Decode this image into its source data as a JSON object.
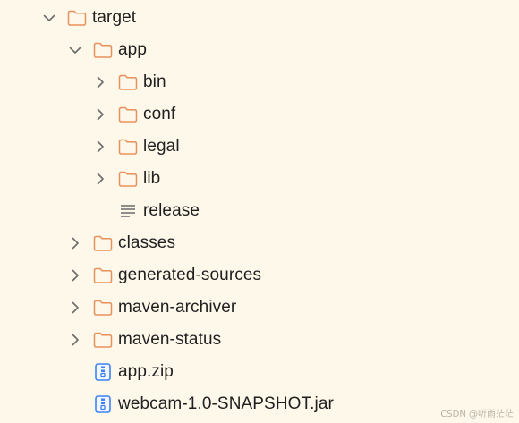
{
  "explorer": {
    "items": [
      {
        "label": "target",
        "type": "folder",
        "expanded": true,
        "depth": 0,
        "icon": "folder-icon"
      },
      {
        "label": "app",
        "type": "folder",
        "expanded": true,
        "depth": 1,
        "icon": "folder-icon"
      },
      {
        "label": "bin",
        "type": "folder",
        "expanded": false,
        "depth": 2,
        "icon": "folder-icon"
      },
      {
        "label": "conf",
        "type": "folder",
        "expanded": false,
        "depth": 2,
        "icon": "folder-icon"
      },
      {
        "label": "legal",
        "type": "folder",
        "expanded": false,
        "depth": 2,
        "icon": "folder-icon"
      },
      {
        "label": "lib",
        "type": "folder",
        "expanded": false,
        "depth": 2,
        "icon": "folder-icon"
      },
      {
        "label": "release",
        "type": "file",
        "depth": 2,
        "icon": "text-file-icon"
      },
      {
        "label": "classes",
        "type": "folder",
        "expanded": false,
        "depth": 1,
        "icon": "folder-icon"
      },
      {
        "label": "generated-sources",
        "type": "folder",
        "expanded": false,
        "depth": 1,
        "icon": "folder-icon"
      },
      {
        "label": "maven-archiver",
        "type": "folder",
        "expanded": false,
        "depth": 1,
        "icon": "folder-icon"
      },
      {
        "label": "maven-status",
        "type": "folder",
        "expanded": false,
        "depth": 1,
        "icon": "folder-icon"
      },
      {
        "label": "app.zip",
        "type": "file",
        "depth": 1,
        "icon": "archive-file-icon"
      },
      {
        "label": "webcam-1.0-SNAPSHOT.jar",
        "type": "file",
        "depth": 1,
        "icon": "archive-file-icon"
      }
    ]
  },
  "watermark": "CSDN @听雨茫茫",
  "colors": {
    "background": "#fdf8ea",
    "folder_stroke": "#e8915a",
    "archive_blue": "#3b82f6",
    "chevron": "#6b6b6b",
    "text": "#1f1f1f"
  }
}
